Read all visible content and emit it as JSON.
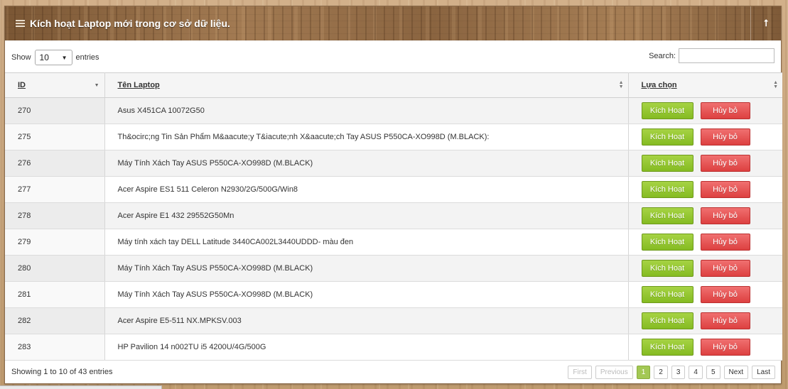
{
  "header": {
    "title": "Kích hoạt Laptop mới trong cơ sở dữ liệu.",
    "collapse_glyph": "⭡"
  },
  "controls": {
    "show_label": "Show",
    "page_size": "10",
    "entries_label": "entries",
    "search_label": "Search:",
    "search_value": ""
  },
  "table": {
    "columns": [
      "ID",
      "Tên Laptop",
      "Lựa chọn"
    ],
    "activate_label": "Kích Hoạt",
    "cancel_label": "Hủy bỏ",
    "rows": [
      {
        "id": "270",
        "name": "Asus X451CA 10072G50"
      },
      {
        "id": "275",
        "name": "Th&ocirc;ng Tin Sản Phẩm M&aacute;y T&iacute;nh X&aacute;ch Tay ASUS P550CA-XO998D (M.BLACK):"
      },
      {
        "id": "276",
        "name": "Máy Tính Xách Tay ASUS P550CA-XO998D (M.BLACK)"
      },
      {
        "id": "277",
        "name": "Acer Aspire ES1 511 Celeron N2930/2G/500G/Win8"
      },
      {
        "id": "278",
        "name": "Acer Aspire E1 432 29552G50Mn"
      },
      {
        "id": "279",
        "name": "Máy tính xách tay DELL Latitude 3440CA002L3440UDDD- màu đen"
      },
      {
        "id": "280",
        "name": "Máy Tính Xách Tay ASUS P550CA-XO998D (M.BLACK)"
      },
      {
        "id": "281",
        "name": "Máy Tính Xách Tay ASUS P550CA-XO998D (M.BLACK)"
      },
      {
        "id": "282",
        "name": "Acer Aspire E5-511 NX.MPKSV.003"
      },
      {
        "id": "283",
        "name": "HP Pavilion 14 n002TU i5 4200U/4G/500G"
      }
    ]
  },
  "footer": {
    "info": "Showing 1 to 10 of 43 entries",
    "pagination": {
      "first": "First",
      "previous": "Previous",
      "pages": [
        "1",
        "2",
        "3",
        "4",
        "5"
      ],
      "current": "1",
      "next": "Next",
      "last": "Last"
    }
  }
}
